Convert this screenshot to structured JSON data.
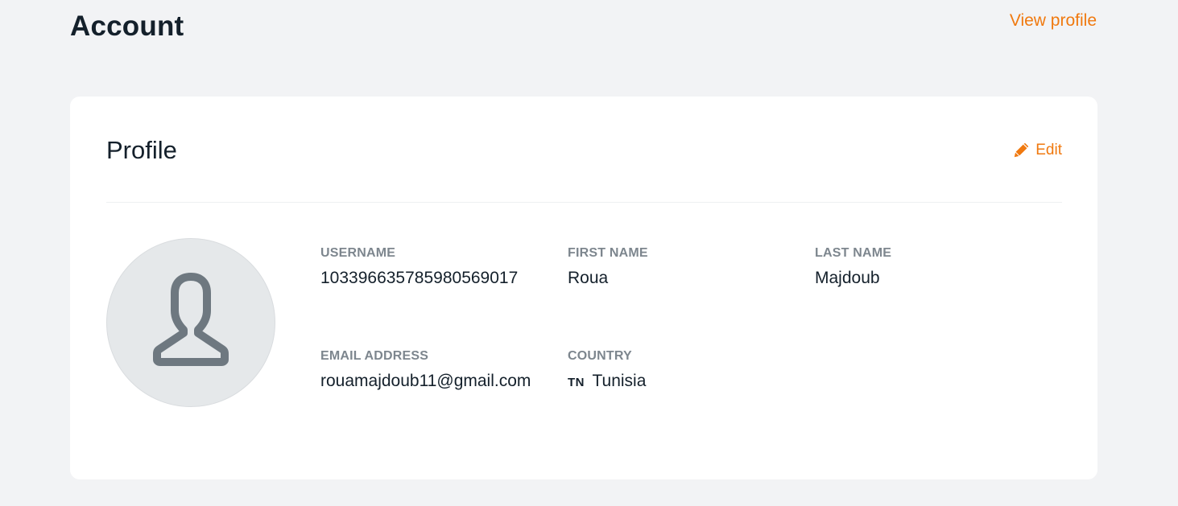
{
  "header": {
    "title": "Account",
    "view_profile_label": "View profile"
  },
  "profile": {
    "title": "Profile",
    "edit_label": "Edit",
    "avatar_icon": "user-outline-icon",
    "fields": {
      "username": {
        "label": "USERNAME",
        "value": "103396635785980569017"
      },
      "first_name": {
        "label": "FIRST NAME",
        "value": "Roua"
      },
      "last_name": {
        "label": "LAST NAME",
        "value": "Majdoub"
      },
      "email": {
        "label": "EMAIL ADDRESS",
        "value": "rouamajdoub11@gmail.com"
      },
      "country": {
        "label": "COUNTRY",
        "flag_code": "TN",
        "value": "Tunisia"
      }
    }
  },
  "colors": {
    "accent": "#f0790f",
    "background": "#f2f3f5",
    "card": "#ffffff",
    "label": "#7d868e",
    "text": "#14202b"
  }
}
